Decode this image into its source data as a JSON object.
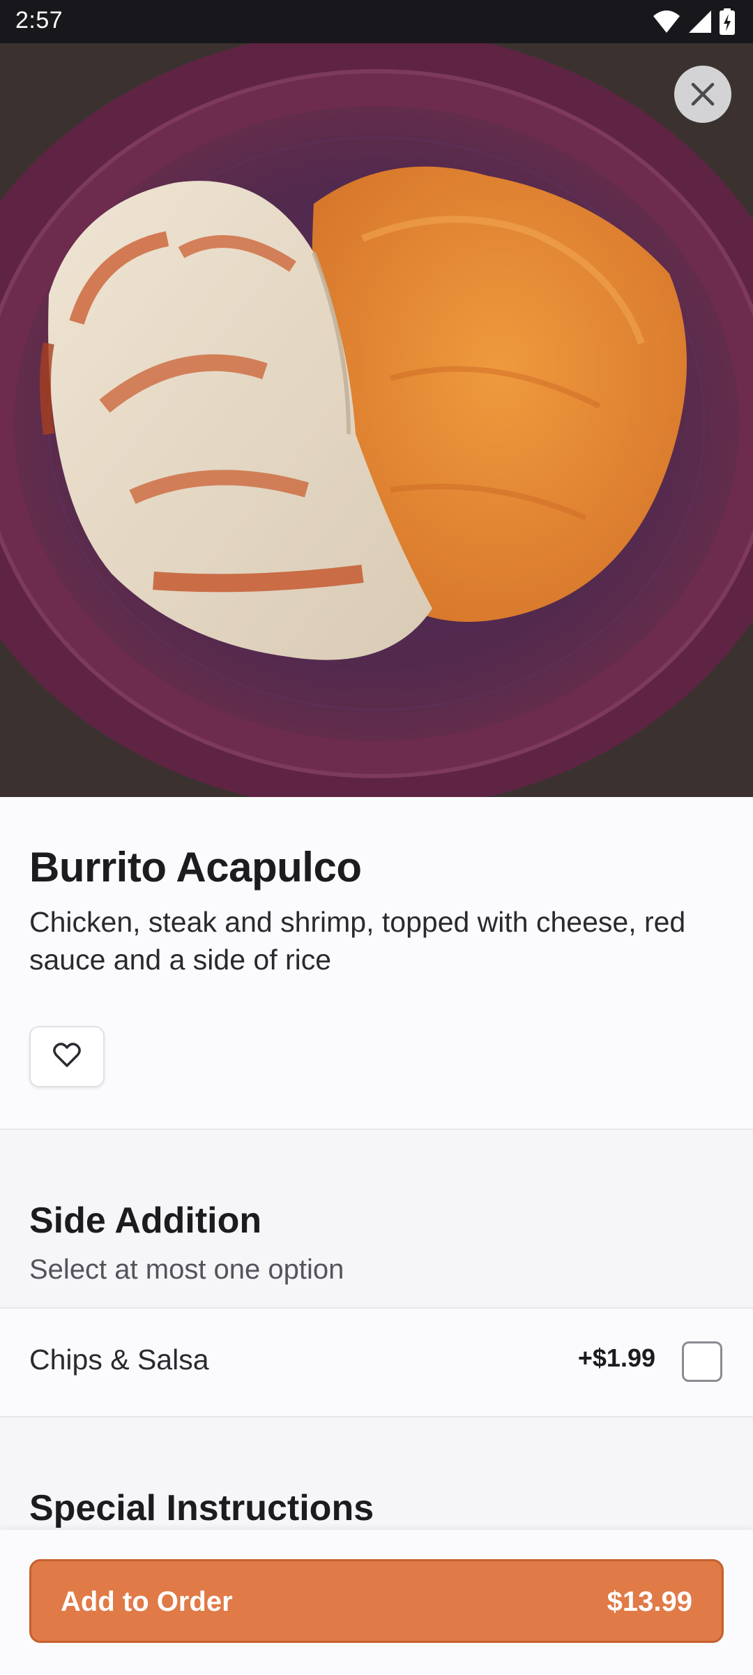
{
  "status_bar": {
    "time": "2:57",
    "icons": [
      "wifi-icon",
      "signal-icon",
      "battery-charging-icon"
    ]
  },
  "hero": {
    "image": "burrito-with-rice-photo",
    "close_icon": "close-icon"
  },
  "item": {
    "title": "Burrito Acapulco",
    "description": "Chicken, steak and shrimp, topped with cheese, red sauce and a side of rice",
    "favorite_icon": "heart-icon"
  },
  "side_addition": {
    "title": "Side Addition",
    "subtitle": "Select at most one option",
    "options": [
      {
        "label": "Chips & Salsa",
        "price": "+$1.99",
        "checked": false
      }
    ]
  },
  "special_instructions": {
    "title": "Special Instructions"
  },
  "order_button": {
    "label": "Add to Order",
    "price": "$13.99"
  },
  "colors": {
    "accent": "#e07a47",
    "status_bar": "#18171b",
    "background": "#f8f7fa"
  }
}
